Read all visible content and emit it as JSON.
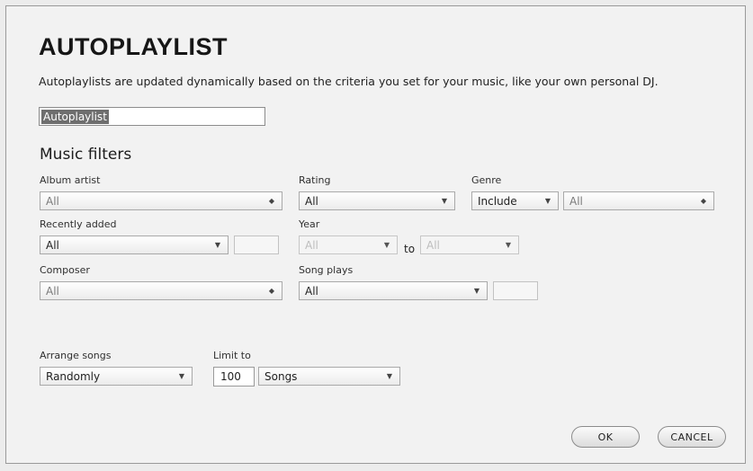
{
  "dialog": {
    "title": "AUTOPLAYLIST",
    "subtitle": "Autoplaylists are updated dynamically based on the criteria you set for your music, like your own personal DJ.",
    "name_value": "Autoplaylist"
  },
  "filters": {
    "heading": "Music filters",
    "album_artist": {
      "label": "Album artist",
      "value": "All"
    },
    "rating": {
      "label": "Rating",
      "value": "All"
    },
    "genre": {
      "label": "Genre",
      "mode": "Include",
      "value": "All"
    },
    "recently_added": {
      "label": "Recently added",
      "value": "All"
    },
    "year": {
      "label": "Year",
      "from": "All",
      "to_label": "to",
      "to": "All"
    },
    "composer": {
      "label": "Composer",
      "value": "All"
    },
    "song_plays": {
      "label": "Song plays",
      "value": "All"
    }
  },
  "arrange": {
    "label": "Arrange songs",
    "value": "Randomly"
  },
  "limit": {
    "label": "Limit to",
    "amount": "100",
    "unit": "Songs"
  },
  "buttons": {
    "ok": "OK",
    "cancel": "CANCEL"
  },
  "icons": {
    "dropdown_arrow": "dropdown-arrow-icon",
    "list_arrow": "list-arrow-icon"
  }
}
